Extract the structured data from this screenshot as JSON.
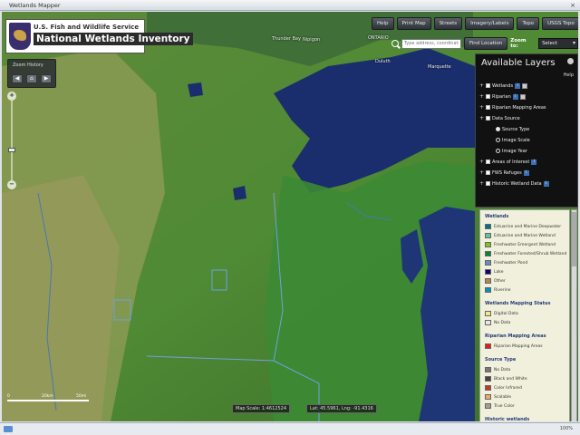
{
  "window": {
    "title": "Wetlands Mapper",
    "close_glyph": "×"
  },
  "logo": {
    "agency": "U.S. Fish and Wildlife Service",
    "product": "National Wetlands Inventory"
  },
  "toolbar": {
    "buttons": [
      "Help",
      "Print Map",
      "Streets",
      "Imagery/Labels",
      "Topo",
      "USGS Topo",
      "⇱"
    ]
  },
  "search": {
    "placeholder": "Type address, coordinates, etc",
    "button": "Find Location",
    "zoom_label": "Zoom to:",
    "zoom_value": "Select"
  },
  "zoom_history": {
    "title": "Zoom History",
    "back": "◀",
    "home": "⌂",
    "forward": "▶"
  },
  "slider": {
    "plus": "+",
    "minus": "−"
  },
  "scale": {
    "left": "0",
    "mid": "20km",
    "right": "50mi"
  },
  "status": {
    "scale": "Map Scale: 1:4612524",
    "coords": "Lat: 45.5961, Lng: -91.4316",
    "zoom": "100%"
  },
  "map_labels": [
    "Thunder Bay",
    "Nipigon",
    "ONTARIO",
    "Duluth",
    "Marquette"
  ],
  "layers": {
    "title": "Available Layers",
    "help": "Help",
    "items": [
      {
        "label": "Wetlands",
        "type": "check",
        "info": true,
        "sym": true
      },
      {
        "label": "Riparian",
        "type": "check",
        "info": true,
        "sym": true
      },
      {
        "label": "Riparian Mapping Areas",
        "type": "check",
        "info": false,
        "sym": false
      },
      {
        "label": "Data Source",
        "type": "check",
        "info": false,
        "sym": false
      },
      {
        "label": "Source Type",
        "type": "radio",
        "info": false,
        "sym": false
      },
      {
        "label": "Image Scale",
        "type": "radio",
        "info": false,
        "sym": false
      },
      {
        "label": "Image Year",
        "type": "radio",
        "info": false,
        "sym": false
      },
      {
        "label": "Areas of Interest",
        "type": "check",
        "info": true,
        "sym": false
      },
      {
        "label": "FWS Refuges",
        "type": "check",
        "info": true,
        "sym": false
      },
      {
        "label": "Historic Wetland Data",
        "type": "check",
        "info": true,
        "sym": false
      }
    ]
  },
  "legend": {
    "wetlands_title": "Wetlands",
    "wetlands": [
      {
        "label": "Estuarine and Marine Deepwater",
        "color": "#006f8a"
      },
      {
        "label": "Estuarine and Marine Wetland",
        "color": "#66c2a5"
      },
      {
        "label": "Freshwater Emergent Wetland",
        "color": "#7fc31c"
      },
      {
        "label": "Freshwater Forested/Shrub Wetland",
        "color": "#008837"
      },
      {
        "label": "Freshwater Pond",
        "color": "#688cc0"
      },
      {
        "label": "Lake",
        "color": "#13007c"
      },
      {
        "label": "Other",
        "color": "#b28653"
      },
      {
        "label": "Riverine",
        "color": "#0190bf"
      }
    ],
    "mapping_title": "Wetlands Mapping Status",
    "mapping": [
      {
        "label": "Digital Data",
        "color": "#f1e88a"
      },
      {
        "label": "No Data",
        "color": "#e6e6e6"
      }
    ],
    "riparian_title": "Riparian Mapping Areas",
    "riparian": [
      {
        "label": "Riparian Mapping Areas",
        "color": "#e41a1c"
      }
    ],
    "source_title": "Source Type",
    "source": [
      {
        "label": "No Data",
        "color": "#777777"
      },
      {
        "label": "Black and White",
        "color": "#444444"
      },
      {
        "label": "Color Infrared",
        "color": "#c0392b"
      },
      {
        "label": "Scalable",
        "color": "#f0a868"
      },
      {
        "label": "True Color",
        "color": "#9aa39a"
      }
    ],
    "historic_title": "Historic wetlands"
  }
}
